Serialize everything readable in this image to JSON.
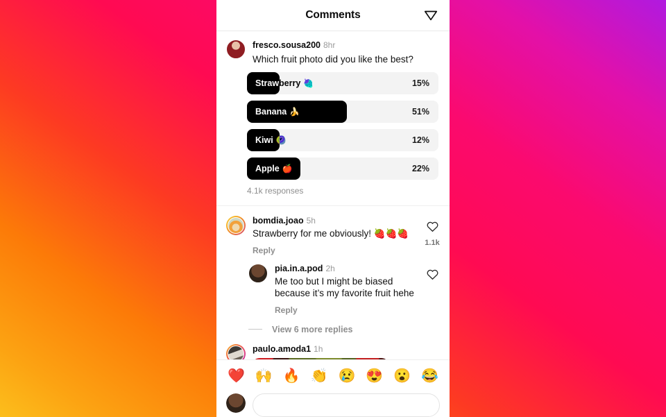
{
  "header": {
    "title": "Comments",
    "share_icon": "share-paper-plane-icon"
  },
  "poll_post": {
    "username": "fresco.sousa200",
    "timestamp": "8hr",
    "question": "Which fruit photo did you like the best?",
    "responses": "4.1k responses",
    "options": [
      {
        "label": "Strawberry",
        "emoji": "🍓",
        "percent": "15%",
        "fill": 17
      },
      {
        "label": "Banana",
        "emoji": "🍌",
        "percent": "51%",
        "fill": 52
      },
      {
        "label": "Kiwi",
        "emoji": "🥝",
        "percent": "12%",
        "fill": 17
      },
      {
        "label": "Apple",
        "emoji": "🍎",
        "percent": "22%",
        "fill": 28
      }
    ]
  },
  "comments": [
    {
      "username": "bomdia.joao",
      "timestamp": "5h",
      "text": "Strawberry for me obviously! 🍓🍓🍓",
      "reply_label": "Reply",
      "like_count": "1.1k"
    },
    {
      "username": "pia.in.a.pod",
      "timestamp": "2h",
      "text": "Me too but I might be biased because it’s my favorite fruit hehe",
      "reply_label": "Reply"
    },
    {
      "username": "paulo.amoda1",
      "timestamp": "1h"
    }
  ],
  "view_more_replies": "View 6 more replies",
  "emoji_bar": [
    "❤️",
    "🙌",
    "🔥",
    "👏",
    "😢",
    "😍",
    "😮",
    "😂"
  ],
  "composer": {
    "placeholder": ""
  },
  "colors": {
    "poll_fill": "#000000",
    "poll_track": "#f3f3f3",
    "accent_pink": "#fb0a6e",
    "accent_purple": "#b01ae0",
    "accent_orange": "#fcbe1c"
  }
}
